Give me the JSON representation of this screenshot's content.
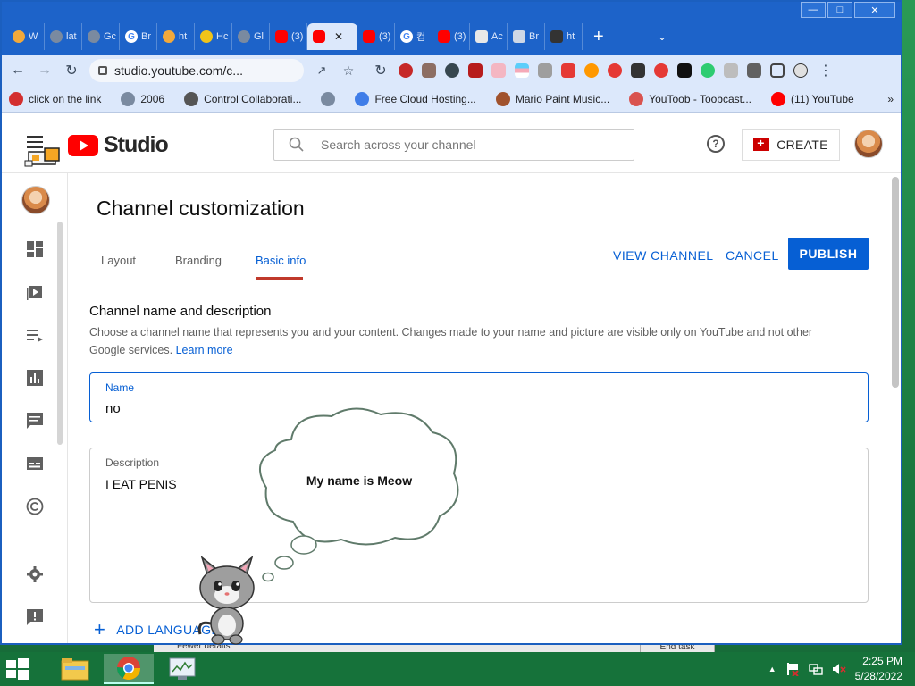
{
  "browser": {
    "tabs": [
      {
        "label": "W",
        "icon": "bitcoin-icon"
      },
      {
        "label": "lat",
        "icon": "globe-icon"
      },
      {
        "label": "Gc",
        "icon": "globe-icon"
      },
      {
        "label": "Br",
        "icon": "google-icon"
      },
      {
        "label": "ht",
        "icon": "bitcoin-icon"
      },
      {
        "label": "Hc",
        "icon": "frog-icon"
      },
      {
        "label": "Gl",
        "icon": "globe-icon"
      },
      {
        "label": "(3)",
        "icon": "youtube-icon"
      },
      {
        "label": "",
        "icon": "youtube-icon",
        "active": true
      },
      {
        "label": "(3)",
        "icon": "youtube-icon"
      },
      {
        "label": "컴",
        "icon": "google-icon"
      },
      {
        "label": "(3)",
        "icon": "youtube-icon"
      },
      {
        "label": "Ac",
        "icon": "app-icon"
      },
      {
        "label": "Br",
        "icon": "box-icon"
      },
      {
        "label": "ht",
        "icon": "menu-icon"
      }
    ],
    "url": "studio.youtube.com/c...",
    "bookmarks": [
      {
        "label": "click on the link",
        "icon": "red-x-icon",
        "color": "#d32f2f"
      },
      {
        "label": "2006",
        "icon": "globe-icon",
        "color": "#7a8aa0"
      },
      {
        "label": "Control Collaborati...",
        "icon": "pawprint-icon",
        "color": "#555555"
      },
      {
        "label": "",
        "icon": "globe-icon",
        "color": "#7a8aa0"
      },
      {
        "label": "Free Cloud Hosting...",
        "icon": "v-icon",
        "color": "#3f7de8"
      },
      {
        "label": "Mario Paint Music...",
        "icon": "mario-icon",
        "color": "#a0522d"
      },
      {
        "label": "YouToob - Toobcast...",
        "icon": "toobcast-icon",
        "color": "#d9534f"
      },
      {
        "label": "(11) YouTube",
        "icon": "youtube-icon",
        "color": "#ff0000"
      }
    ]
  },
  "studio": {
    "logo_text": "Studio",
    "search_placeholder": "Search across your channel",
    "create_label": "CREATE",
    "page_title": "Channel customization",
    "tabs": [
      "Layout",
      "Branding",
      "Basic info"
    ],
    "active_tab": "Basic info",
    "view_channel": "VIEW CHANNEL",
    "cancel": "CANCEL",
    "publish": "PUBLISH",
    "section_title": "Channel name and description",
    "section_desc": "Choose a channel name that represents you and your content. Changes made to your name and picture are visible only on YouTube and not other Google services.",
    "learn_more": "Learn more",
    "name_label": "Name",
    "name_value": "no",
    "description_label": "Description",
    "description_value": "I EAT PENIS",
    "add_language": "ADD LANGUAGE",
    "accent_color": "#065fd4",
    "brand_color": "#ff0000"
  },
  "overlay": {
    "bubble_text": "My name is Meow"
  },
  "behind_window": {
    "fewer_details": "Fewer details",
    "end_task": "End task"
  },
  "taskbar": {
    "time": "2:25 PM",
    "date": "5/28/2022",
    "tray_arrow": "▲"
  }
}
